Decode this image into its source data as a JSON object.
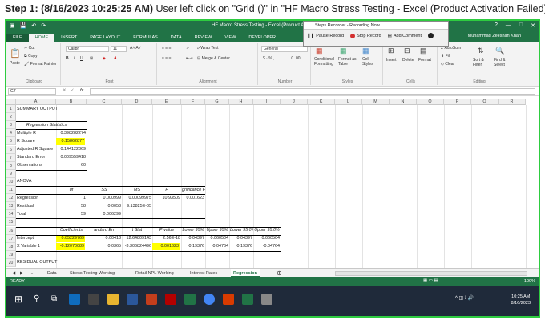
{
  "step": {
    "prefix": "Step 1: (8/16/2023 10:25:25 AM)",
    "text": " User left click on \"Grid ()\" in \"HF Macro Stress Testing - Excel (Product Activation Failed)\""
  },
  "window": {
    "title": "HF Macro Stress Testing - Excel (Product Activat",
    "user": "Muhammad Zeeshan Khan",
    "controls": [
      "?",
      "—",
      "□",
      "✕"
    ]
  },
  "ribbon_tabs": [
    "FILE",
    "HOME",
    "INSERT",
    "PAGE LAYOUT",
    "FORMULAS",
    "DATA",
    "REVIEW",
    "VIEW",
    "DEVELOPER"
  ],
  "recorder": {
    "title": "Steps Recorder - Recording Now",
    "pause": "Pause Record",
    "stop": "Stop Record",
    "add_comment": "Add Comment"
  },
  "ribbon": {
    "clipboard": {
      "paste": "Paste",
      "cut": "Cut",
      "copy": "Copy",
      "format_painter": "Format Painter",
      "label": "Clipboard"
    },
    "font": {
      "name": "Calibri",
      "size": "11",
      "label": "Font"
    },
    "alignment": {
      "wrap": "Wrap Text",
      "merge": "Merge & Center",
      "label": "Alignment"
    },
    "number": {
      "format": "General",
      "label": "Number"
    },
    "styles": {
      "cond": "Conditional Formatting",
      "table": "Format as Table",
      "cell": "Cell Styles",
      "label": "Styles"
    },
    "cells": {
      "insert": "Insert",
      "delete": "Delete",
      "format": "Format",
      "label": "Cells"
    },
    "editing": {
      "autosum": "AutoSum",
      "fill": "Fill",
      "clear": "Clear",
      "sort": "Sort & Filter",
      "find": "Find & Select",
      "label": "Editing"
    }
  },
  "formula_bar": {
    "name_box": "G7",
    "fx": "fx",
    "value": ""
  },
  "columns": [
    "A",
    "B",
    "C",
    "D",
    "E",
    "F",
    "G",
    "H",
    "I",
    "J",
    "K",
    "L",
    "M",
    "N",
    "O",
    "P",
    "Q",
    "R"
  ],
  "rows": [
    "1",
    "2",
    "3",
    "4",
    "5",
    "6",
    "7",
    "8",
    "9",
    "10",
    "11",
    "12",
    "13",
    "14",
    "15",
    "16",
    "17",
    "18",
    "19",
    "20"
  ],
  "cells": {
    "a1": "SUMMARY OUTPUT",
    "a3": "Regression Statistics",
    "a4": "Multiple R",
    "b4": "0.398282274",
    "a5": "R Square",
    "b5": "0.15862877",
    "a6": "Adjusted R Square",
    "b6": "0.144122369",
    "a7": "Standard Error",
    "b7": "0.009559418",
    "a8": "Observations",
    "b8": "60",
    "a10": "ANOVA",
    "b11": "df",
    "c11": "SS",
    "d11": "MS",
    "e11": "F",
    "f11": "gnificance F",
    "a12": "Regression",
    "b12": "1",
    "c12": "0.000999",
    "d12": "0.00099975",
    "e12": "10.93509",
    "f12": "0.001623",
    "a13": "Residual",
    "b13": "58",
    "c13": "0.0053",
    "d13": "9.13825E-05",
    "a14": "Total",
    "b14": "59",
    "c14": "0.006299",
    "b16": "Coefficients",
    "c16": "andard Err",
    "d16": "t Stat",
    "e16": "P-value",
    "f16": "Lower 95%",
    "g16": "Upper 95%",
    "h16": "Lower 95.0%",
    "i16": "Upper 95.0%",
    "a17": "Intercept",
    "b17": "0.05229769",
    "c17": "0.00413",
    "d17": "12.64809143",
    "e17": "2.56E-18",
    "f17": "0.04397",
    "g17": "0.060504",
    "h17": "0.04397",
    "i17": "0.060504",
    "a18": "X Variable 1",
    "b18": "-0.12070089",
    "c18": "0.0365",
    "d18": "-3.306824496",
    "e18": "0.001623",
    "f18": "-0.19376",
    "g18": "-0.04764",
    "h18": "-0.19376",
    "i18": "-0.04764",
    "a20": "RESIDUAL OUTPUT"
  },
  "sheet_tabs": [
    "Data",
    "Stress Testing Working",
    "Retail NPL Working",
    "Interest Rates",
    "Regression"
  ],
  "sheet_nav": [
    "◀",
    "▶",
    "..."
  ],
  "status": {
    "ready": "READY",
    "zoom": "100%"
  },
  "clock": {
    "time": "10:25 AM",
    "date": "8/16/2023"
  },
  "colors": {
    "excel_green": "#217346",
    "highlight": "#ffff00",
    "frame": "#2ecc40"
  }
}
